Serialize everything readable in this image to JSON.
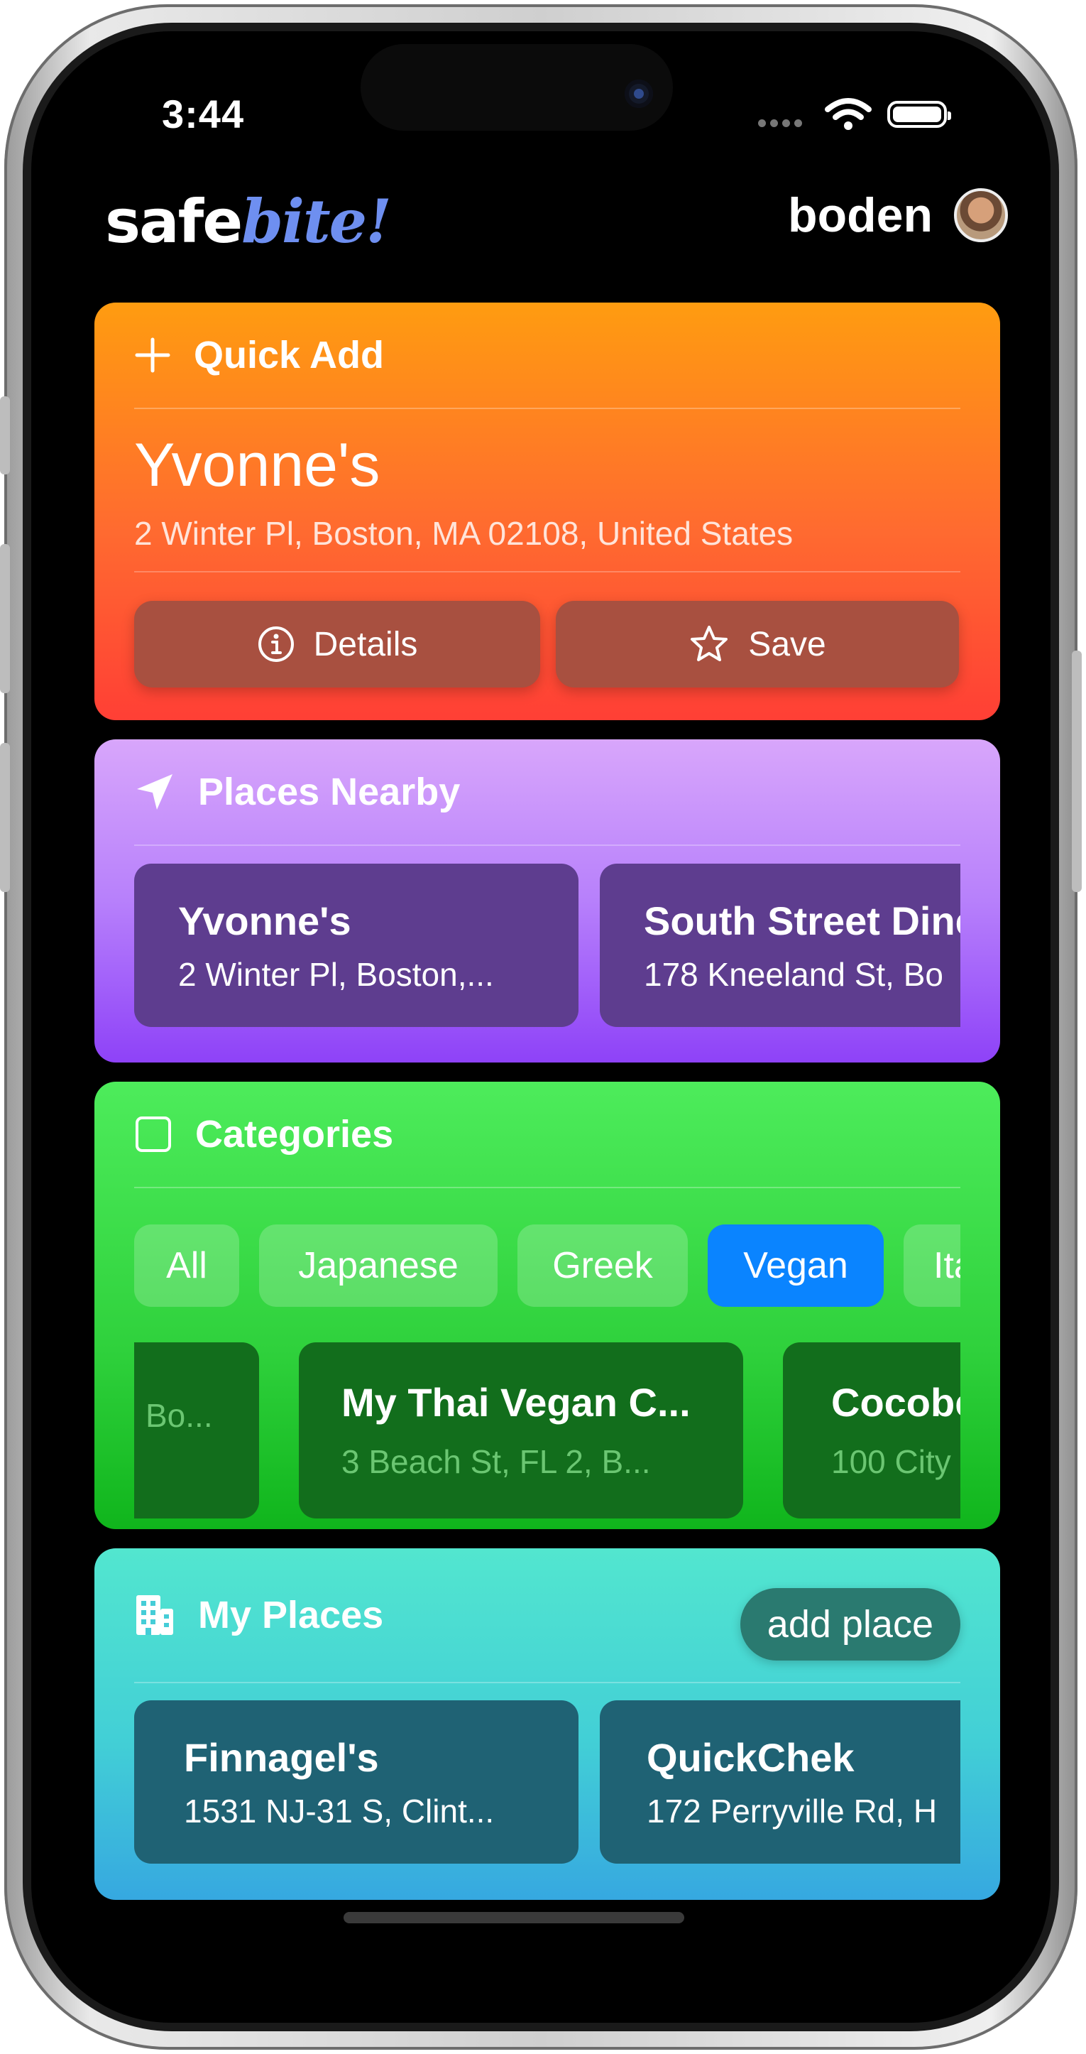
{
  "status_bar": {
    "time": "3:44"
  },
  "header": {
    "logo_part1": "safe",
    "logo_part2": "bite!",
    "username": "boden"
  },
  "quick_add": {
    "title": "Quick Add",
    "place_name": "Yvonne's",
    "place_address": "2 Winter Pl, Boston, MA  02108, United States",
    "details_label": "Details",
    "save_label": "Save"
  },
  "places_nearby": {
    "title": "Places Nearby",
    "items": [
      {
        "name": "Yvonne's",
        "address": "2 Winter Pl, Boston,..."
      },
      {
        "name": "South Street Dine",
        "address": "178 Kneeland St, Bo"
      }
    ]
  },
  "categories": {
    "title": "Categories",
    "chips": [
      "All",
      "Japanese",
      "Greek",
      "Vegan",
      "Ita"
    ],
    "selected": "Vegan",
    "items": [
      {
        "name": "",
        "address": "Bo..."
      },
      {
        "name": "My Thai Vegan C...",
        "address": "3 Beach St, FL 2, B..."
      },
      {
        "name": "Cocobe",
        "address": "100 City"
      }
    ]
  },
  "my_places": {
    "title": "My Places",
    "add_label": "add place",
    "items": [
      {
        "name": "Finnagel's",
        "address": "1531 NJ-31 S, Clint..."
      },
      {
        "name": "QuickChek",
        "address": "172 Perryville Rd, H"
      }
    ]
  },
  "icons": {
    "quick_add": "plus-icon",
    "details": "info-icon",
    "save": "star-icon",
    "nearby": "location-arrow-icon",
    "categories": "square-icon",
    "my_places": "building-icon",
    "wifi": "wifi-icon",
    "battery": "battery-icon"
  },
  "colors": {
    "quick_add_top": "#ff9c10",
    "quick_add_bottom": "#ff3f35",
    "nearby_top": "#d8a6fb",
    "nearby_bottom": "#8e42f8",
    "categories_top": "#4dec5b",
    "categories_bottom": "#10b51c",
    "my_places_top": "#52e6cf",
    "my_places_bottom": "#36a8e0",
    "accent_selected": "#0a84ff",
    "logo_accent": "#6e8ff0"
  }
}
